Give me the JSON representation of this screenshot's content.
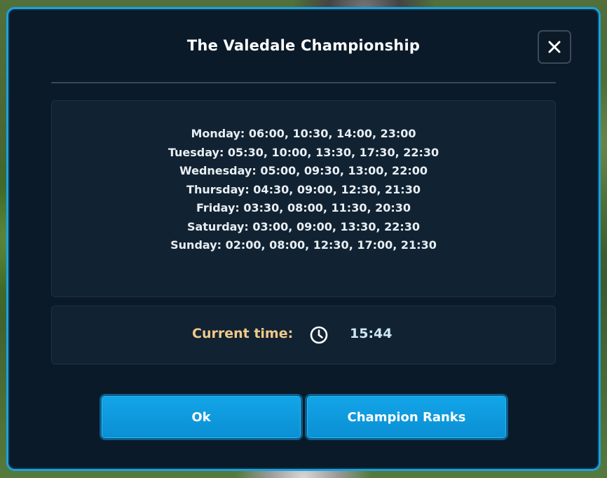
{
  "dialog": {
    "title": "The Valedale Championship",
    "close_icon": "close-icon"
  },
  "schedule": [
    "Monday: 06:00, 10:30, 14:00, 23:00",
    "Tuesday: 05:30, 10:00, 13:30, 17:30, 22:30",
    "Wednesday: 05:00, 09:30, 13:00, 22:00",
    "Thursday: 04:30, 09:00, 12:30, 21:30",
    "Friday: 03:30, 08:00, 11:30, 20:30",
    "Saturday: 03:00, 09:00, 13:30, 22:30",
    "Sunday: 02:00, 08:00, 12:30, 17:00, 21:30"
  ],
  "current_time": {
    "label": "Current time:",
    "icon": "clock-icon",
    "value": "15:44"
  },
  "buttons": {
    "ok_label": "Ok",
    "ranks_label": "Champion Ranks"
  },
  "colors": {
    "accent": "#1ea1dd",
    "button": "#0b8fd4",
    "label_gold": "#f0c98a",
    "panel": "#112232",
    "dialog_bg": "#0b1a29"
  }
}
